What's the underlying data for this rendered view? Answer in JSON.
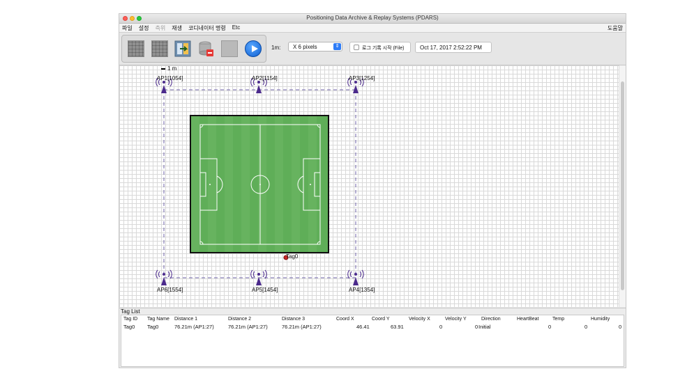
{
  "window": {
    "title": "Positioning Data Archive & Replay Systems (PDARS)"
  },
  "menu": {
    "items": [
      {
        "label": "파일",
        "disabled": false
      },
      {
        "label": "설정",
        "disabled": false
      },
      {
        "label": "측위",
        "disabled": true
      },
      {
        "label": "재생",
        "disabled": false
      },
      {
        "label": "코디네이터 명령",
        "disabled": false
      },
      {
        "label": "Etc",
        "disabled": false
      }
    ],
    "help": "도움말"
  },
  "toolbar": {
    "scale_label": "1m:",
    "scale_value": "X 6 pixels",
    "log_label": "로그 기록 시작 (File)",
    "datetime": "Oct 17, 2017 2:52:22 PM",
    "icons": [
      "grid-icon",
      "grid-icon",
      "import-icon",
      "database-delete-icon",
      "grid-disabled-icon",
      "play-icon"
    ]
  },
  "map": {
    "scale_legend": "1 m",
    "access_points": [
      {
        "label": "AP1[1054]"
      },
      {
        "label": "AP2[1154]"
      },
      {
        "label": "AP3[1254]"
      },
      {
        "label": "AP4[1354]"
      },
      {
        "label": "AP5[1454]"
      },
      {
        "label": "AP6[1554]"
      }
    ],
    "tag": {
      "label": "Tag0"
    }
  },
  "taglist": {
    "title": "Tag List",
    "columns": [
      "Tag ID",
      "Tag Name",
      "Distance 1",
      "Distance 2",
      "Distance 3",
      "Coord X",
      "Coord Y",
      "Velocity X",
      "Velocity Y",
      "Direction",
      "HeartBeat",
      "Temp",
      "Humidity"
    ],
    "rows": [
      {
        "tag_id": "Tag0",
        "tag_name": "Tag0",
        "distance1": "76.21m (AP1:27)",
        "distance2": "76.21m (AP1:27)",
        "distance3": "76.21m (AP1:27)",
        "coord_x": "46.41",
        "coord_y": "63.91",
        "velocity_x": "0",
        "velocity_y": "0",
        "direction": "Initial",
        "heartbeat": "0",
        "temp": "0",
        "humidity": "0"
      }
    ]
  },
  "colors": {
    "ap_icon": "#4b2a8c",
    "field_green": "#5fae58",
    "boundary_line": "#6f63a8",
    "tag_dot": "#c62828"
  }
}
